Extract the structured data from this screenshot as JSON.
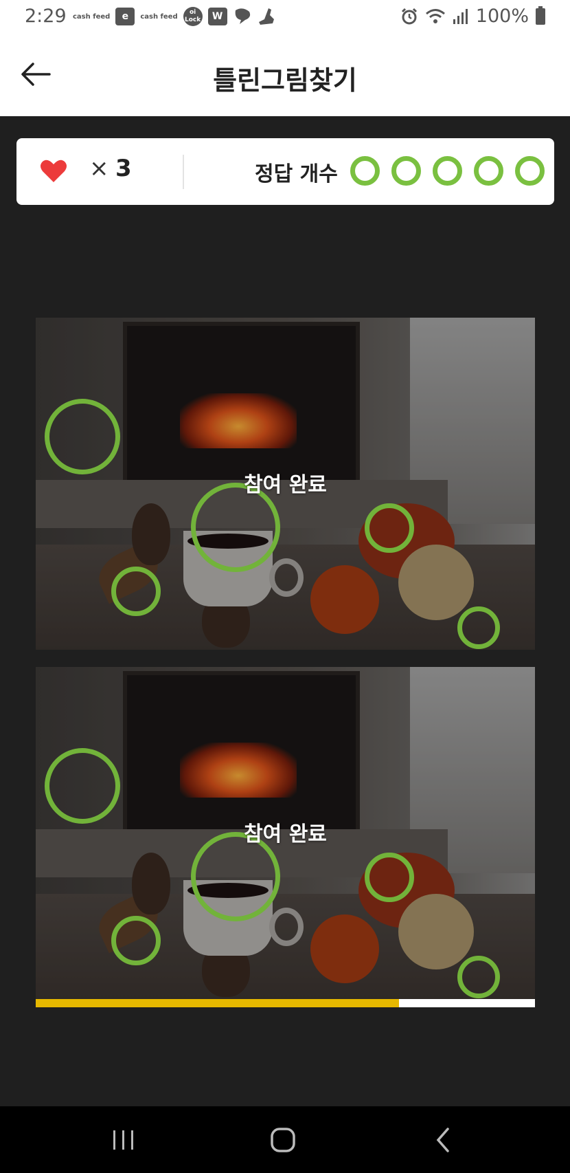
{
  "status_bar": {
    "time": "2:29",
    "notification_icons": [
      "cash feed",
      "e",
      "cash feed",
      "oi Lock",
      "W",
      "bubble",
      "shoe"
    ],
    "battery_text": "100%"
  },
  "header": {
    "title": "틀린그림찾기"
  },
  "score_card": {
    "times_symbol": "×",
    "lives": "3",
    "answers_label": "정답 개수",
    "answers_found": 5,
    "answers_total": 5,
    "accent_color": "#7ac040",
    "heart_color": "#ec3b3b"
  },
  "images": [
    {
      "id": "original",
      "overlay_text": "참여 완료",
      "found_count": 5
    },
    {
      "id": "modified",
      "overlay_text": "참여 완료",
      "found_count": 5
    }
  ],
  "progress": {
    "fraction": 0.728,
    "fill_color": "#e6b800"
  },
  "nav_bar": {
    "icons": [
      "recent-apps-icon",
      "home-icon",
      "back-icon"
    ]
  }
}
